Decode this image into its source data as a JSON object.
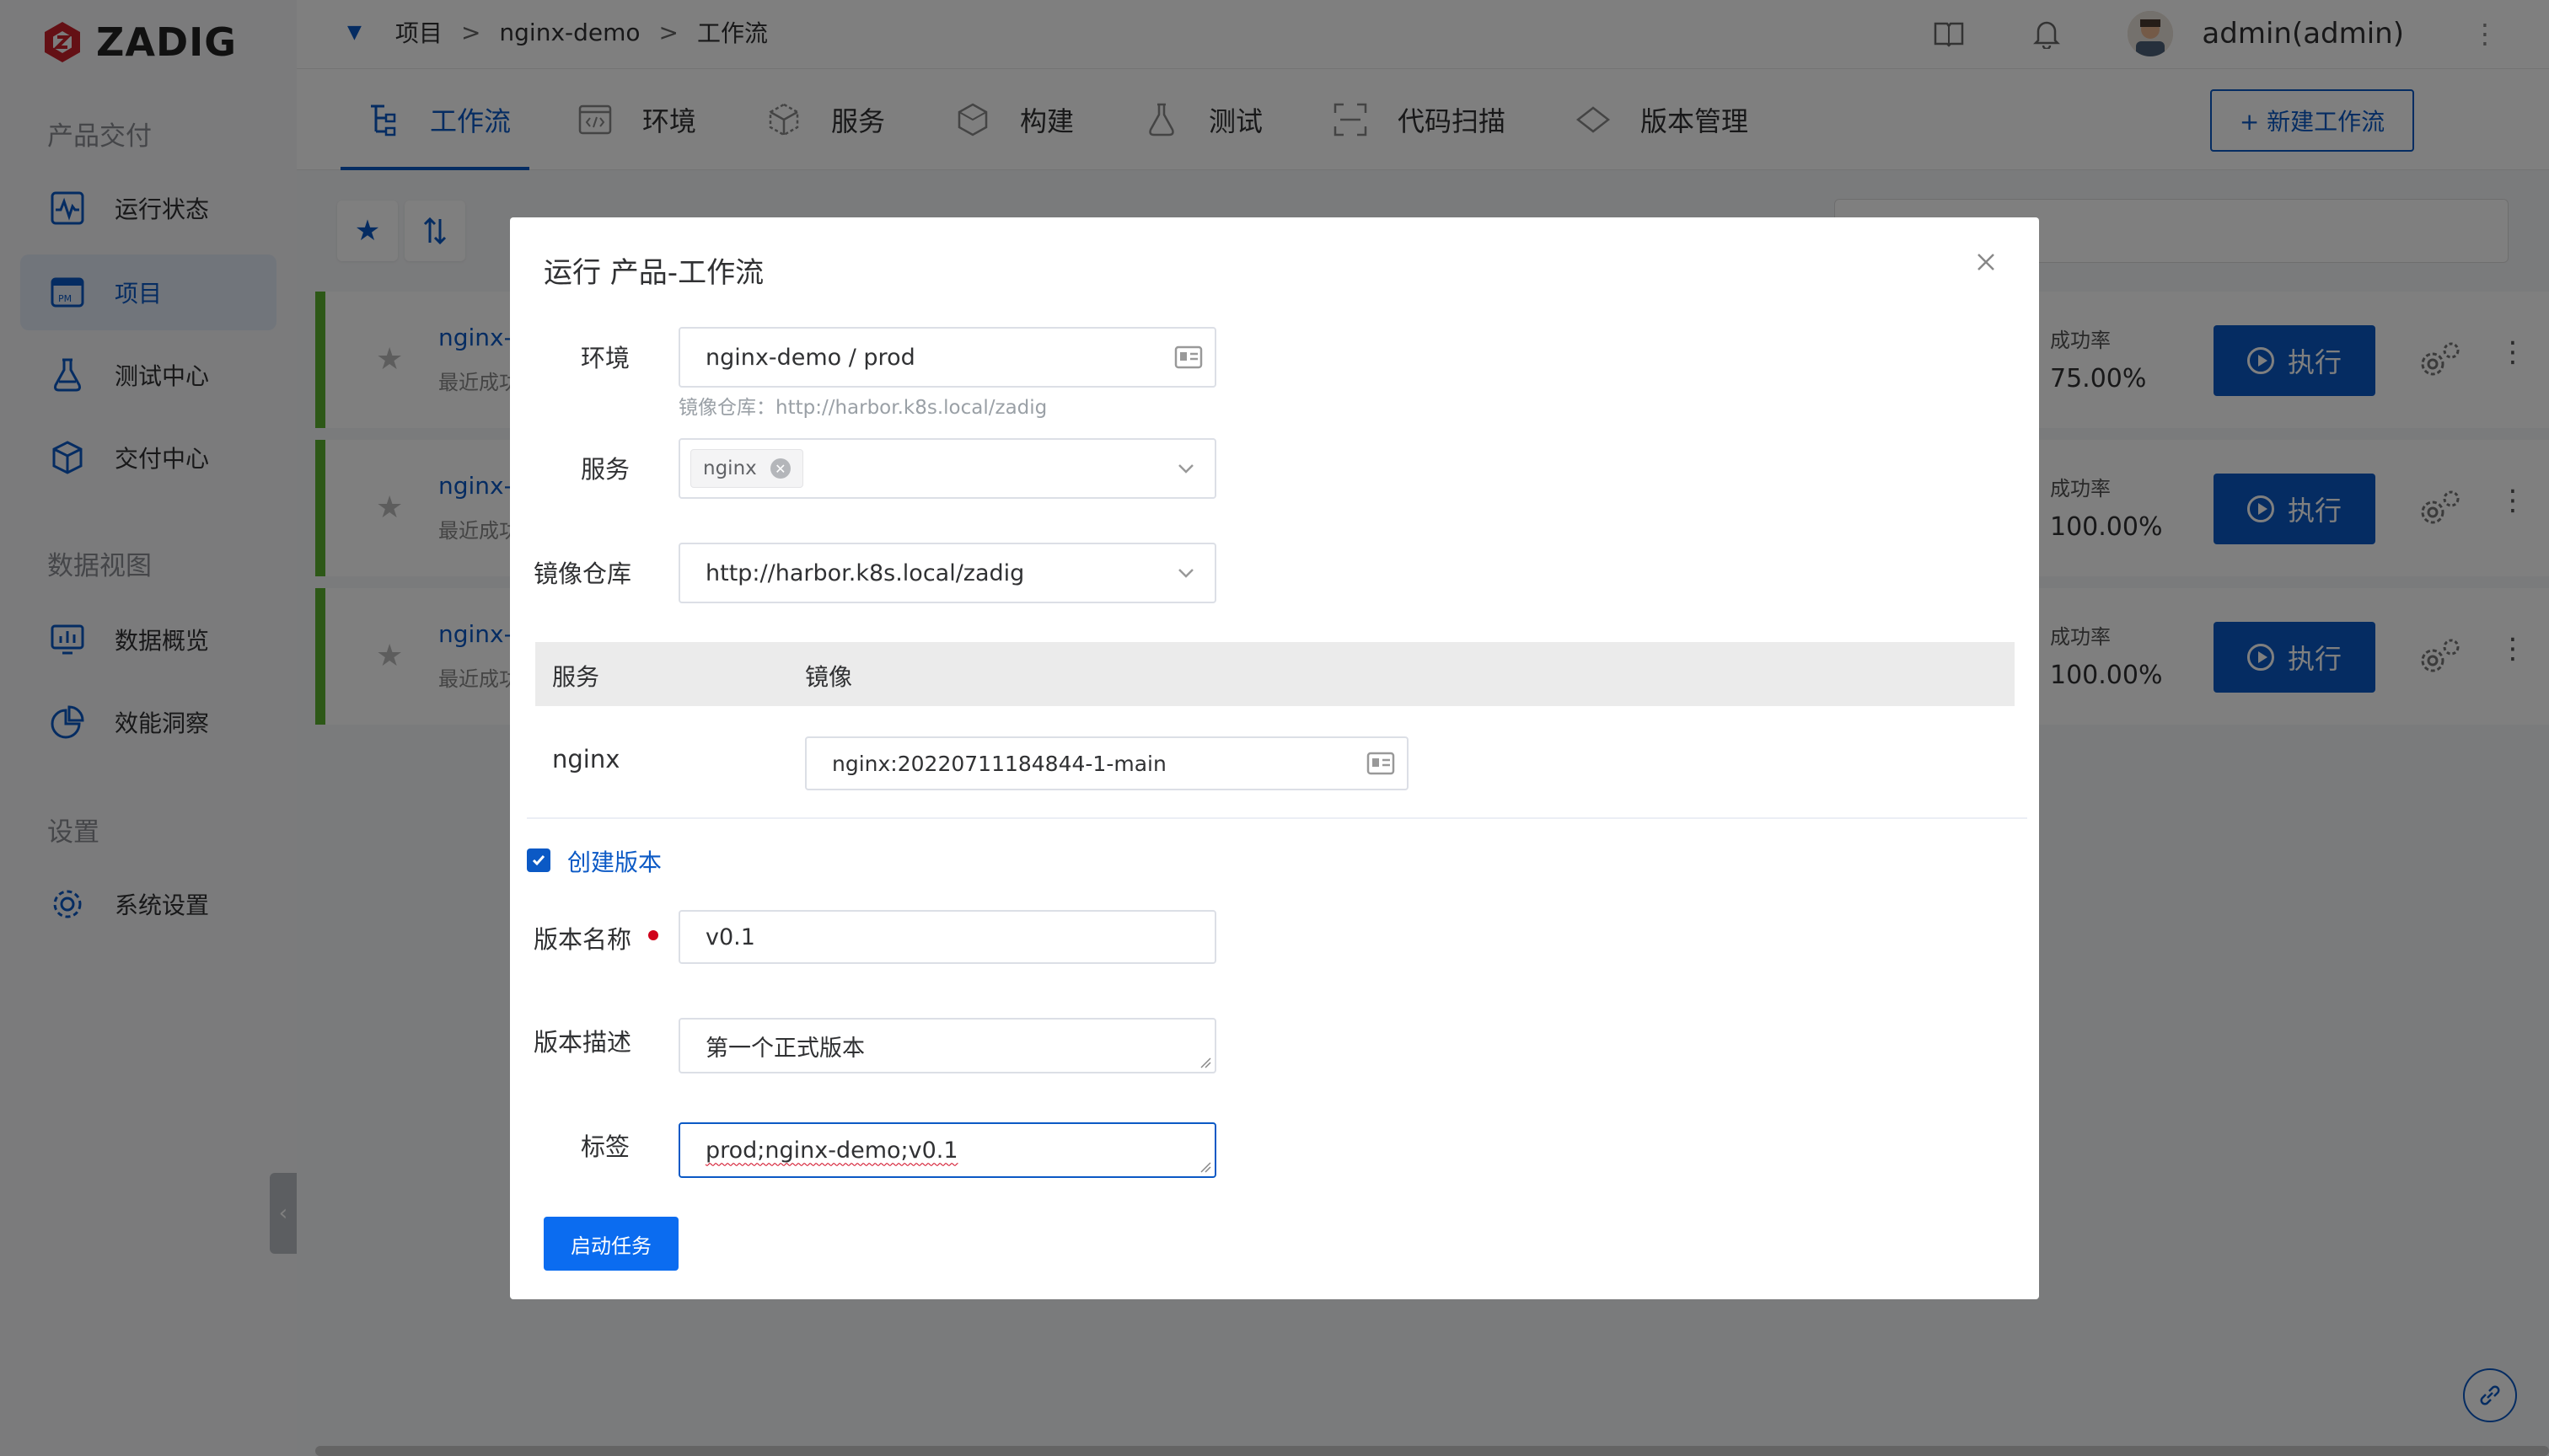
{
  "app": {
    "logo_text": "ZADIG"
  },
  "sidebar": {
    "section1": "产品交付",
    "section2": "数据视图",
    "section3": "设置",
    "items": [
      {
        "label": "运行状态",
        "icon": "pulse-icon"
      },
      {
        "label": "项目",
        "icon": "project-icon"
      },
      {
        "label": "测试中心",
        "icon": "flask-icon"
      },
      {
        "label": "交付中心",
        "icon": "package-icon"
      },
      {
        "label": "数据概览",
        "icon": "dashboard-icon"
      },
      {
        "label": "效能洞察",
        "icon": "pie-chart-icon"
      },
      {
        "label": "系统设置",
        "icon": "gear-icon"
      }
    ]
  },
  "breadcrumb": {
    "items": [
      "项目",
      "nginx-demo",
      "工作流"
    ],
    "separator": ">"
  },
  "user": {
    "name": "admin(admin)"
  },
  "tabs": [
    {
      "label": "工作流",
      "icon": "workflow-icon"
    },
    {
      "label": "环境",
      "icon": "code-window-icon"
    },
    {
      "label": "服务",
      "icon": "cube-icon"
    },
    {
      "label": "构建",
      "icon": "hexagon-icon"
    },
    {
      "label": "测试",
      "icon": "flask-icon"
    },
    {
      "label": "代码扫描",
      "icon": "scan-icon"
    },
    {
      "label": "版本管理",
      "icon": "diamond-icon"
    }
  ],
  "new_workflow_label": "+ 新建工作流",
  "workflows": [
    {
      "name": "nginx-d",
      "sub": "最近成功",
      "rate_label": "成功率",
      "rate": "75.00%",
      "run_label": "执行"
    },
    {
      "name": "nginx-d",
      "sub": "最近成功",
      "rate_label": "成功率",
      "rate": "100.00%",
      "run_label": "执行"
    },
    {
      "name": "nginx-d",
      "sub": "最近成功",
      "rate_label": "成功率",
      "rate": "100.00%",
      "run_label": "执行"
    }
  ],
  "modal": {
    "title": "运行 产品-工作流",
    "env_label": "环境",
    "env_value": "nginx-demo / prod",
    "registry_hint": "镜像仓库：http://harbor.k8s.local/zadig",
    "service_label": "服务",
    "service_tag": "nginx",
    "registry_label": "镜像仓库",
    "registry_value": "http://harbor.k8s.local/zadig",
    "table_headers": [
      "服务",
      "镜像"
    ],
    "table_rows": [
      {
        "service": "nginx",
        "image": "nginx:20220711184844-1-main"
      }
    ],
    "create_version_label": "创建版本",
    "create_version_checked": true,
    "version_name_label": "版本名称",
    "version_name_value": "v0.1",
    "version_desc_label": "版本描述",
    "version_desc_value": "第一个正式版本",
    "tags_label": "标签",
    "tags_value": "prod;nginx-demo;v0.1",
    "start_label": "启动任务"
  },
  "colors": {
    "primary": "#0b59c5",
    "success_bar": "#5bb12f",
    "required": "#d0021b"
  }
}
